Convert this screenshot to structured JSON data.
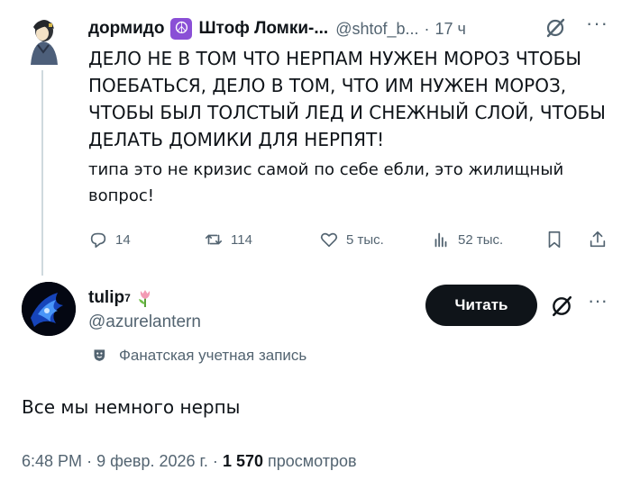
{
  "parent_tweet": {
    "display_name_1": "дормидо",
    "display_name_2": "Штоф Ломки-...",
    "handle": "@shtof_b...",
    "dot": "·",
    "time": "17 ч",
    "more": "···",
    "text_lines": [
      "ДЕЛО НЕ В ТОМ ЧТО НЕРПАМ НУЖЕН МОРОЗ ЧТОБЫ",
      "ПОЕБАТЬСЯ, ДЕЛО В ТОМ, ЧТО ИМ НУЖЕН МОРОЗ,",
      "ЧТОБЫ БЫЛ ТОЛСТЫЙ ЛЕД И СНЕЖНЫЙ СЛОЙ, ЧТОБЫ",
      "ДЕЛАТЬ ДОМИКИ ДЛЯ НЕРПЯТ!"
    ],
    "text_small_lines": [
      "типа это не кризис самой по себе ебли, это жилищный",
      "вопрос!"
    ],
    "actions": {
      "replies": "14",
      "reposts": "114",
      "likes": "5 тыс.",
      "views": "52 тыс."
    },
    "peace_icon": "peace-symbol-icon"
  },
  "main_tweet": {
    "display_name": "tulip",
    "superscript": "7",
    "emoji": "tulip-emoji-icon",
    "handle": "@azurelantern",
    "follow_label": "Читать",
    "more": "···",
    "fan_label": "Фанатская учетная запись",
    "text": "Все мы немного нерпы",
    "time": "6:48 PM",
    "sep1": "·",
    "date": "9 февр. 2026 г.",
    "sep2": "·",
    "views_count": "1 570",
    "views_label": "просмотров"
  },
  "colors": {
    "text": "#0f1419",
    "secondary": "#536471",
    "follow_bg": "#0f1419",
    "peace_bg": "#8a4fd6",
    "thread_line": "#cfd9de"
  }
}
